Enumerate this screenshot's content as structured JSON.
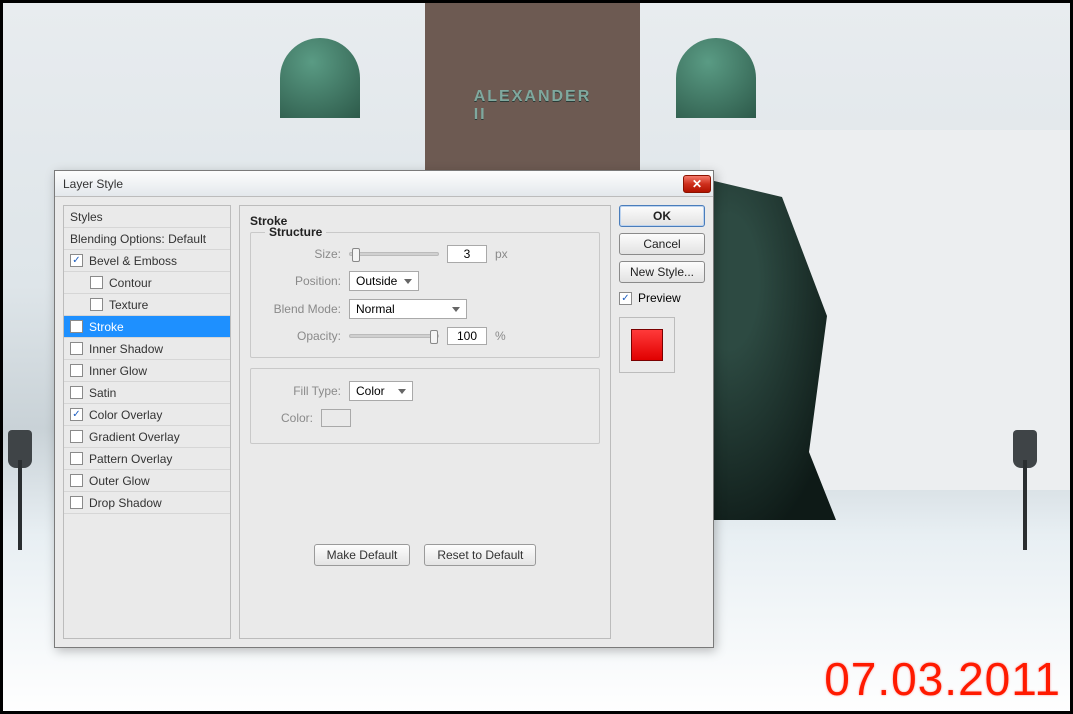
{
  "background": {
    "pedestal_text": "ALEXANDER II",
    "datestamp": "07.03.2011"
  },
  "dialog": {
    "title": "Layer Style",
    "close_glyph": "✕",
    "sidebar": {
      "styles_header": "Styles",
      "blending_header": "Blending Options: Default",
      "items": [
        {
          "label": "Bevel & Emboss",
          "checked": true,
          "sub": false
        },
        {
          "label": "Contour",
          "checked": false,
          "sub": true
        },
        {
          "label": "Texture",
          "checked": false,
          "sub": true
        },
        {
          "label": "Stroke",
          "checked": false,
          "sub": false,
          "selected": true
        },
        {
          "label": "Inner Shadow",
          "checked": false,
          "sub": false
        },
        {
          "label": "Inner Glow",
          "checked": false,
          "sub": false
        },
        {
          "label": "Satin",
          "checked": false,
          "sub": false
        },
        {
          "label": "Color Overlay",
          "checked": true,
          "sub": false
        },
        {
          "label": "Gradient Overlay",
          "checked": false,
          "sub": false
        },
        {
          "label": "Pattern Overlay",
          "checked": false,
          "sub": false
        },
        {
          "label": "Outer Glow",
          "checked": false,
          "sub": false
        },
        {
          "label": "Drop Shadow",
          "checked": false,
          "sub": false
        }
      ]
    },
    "main": {
      "title": "Stroke",
      "structure": {
        "legend": "Structure",
        "size_label": "Size:",
        "size_value": "3",
        "size_unit": "px",
        "position_label": "Position:",
        "position_value": "Outside",
        "blendmode_label": "Blend Mode:",
        "blendmode_value": "Normal",
        "opacity_label": "Opacity:",
        "opacity_value": "100",
        "opacity_unit": "%"
      },
      "fill": {
        "filltype_label": "Fill Type:",
        "filltype_value": "Color",
        "color_label": "Color:"
      },
      "make_default": "Make Default",
      "reset_default": "Reset to Default"
    },
    "right": {
      "ok": "OK",
      "cancel": "Cancel",
      "new_style": "New Style...",
      "preview_label": "Preview",
      "preview_checked": true,
      "swatch_color": "#e00000"
    }
  }
}
